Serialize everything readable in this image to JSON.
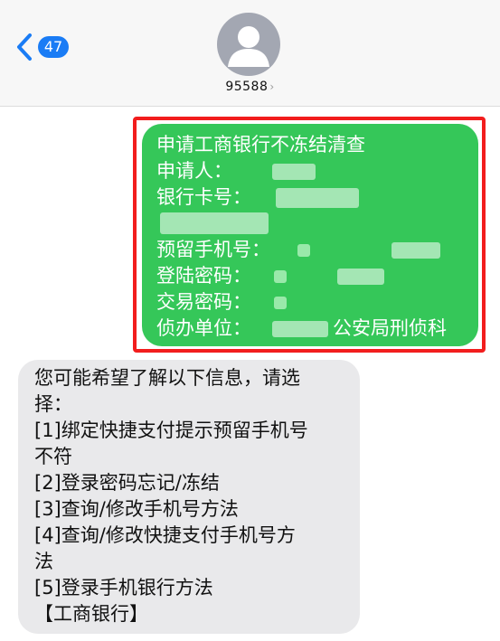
{
  "header": {
    "back_badge": "47",
    "contact_name": "95588",
    "chevron": "›"
  },
  "outgoing": {
    "lines": [
      "申请工商银行不冻结清查",
      "申请人：",
      "银行卡号：",
      "",
      "预留手机号：",
      "登陆密码：",
      "交易密码：",
      "侦办单位：",
      "公安局刑侦科"
    ]
  },
  "incoming": {
    "lines": [
      "您可能希望了解以下信息，请选",
      "择：",
      "[1]绑定快捷支付提示预留手机号",
      "不符",
      "[2]登录密码忘记/冻结",
      "[3]查询/修改手机号方法",
      "[4]查询/修改快捷支付手机号方",
      "法",
      "[5]登录手机银行方法",
      "【工商银行】"
    ]
  },
  "colors": {
    "outgoing_bubble": "#35c759",
    "incoming_bubble": "#e9e9eb",
    "highlight_border": "#f21d1d",
    "badge": "#1a7cf5"
  },
  "icons": {
    "back": "chevron-left-icon",
    "avatar": "person-avatar-icon"
  }
}
